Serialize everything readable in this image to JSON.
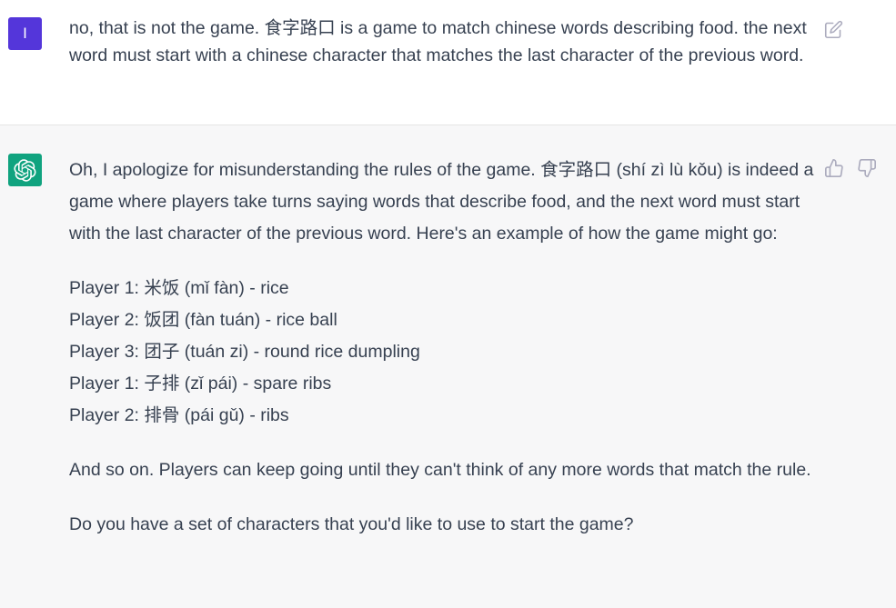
{
  "user_message": {
    "avatar_initial": "I",
    "text": "no, that is not the game. 食字路口 is a game to match chinese words describing food. the next word must start with a chinese character that matches the last character of the previous word."
  },
  "assistant_message": {
    "intro": "Oh, I apologize for misunderstanding the rules of the game. 食字路口 (shí zì lù kǒu) is indeed a game where players take turns saying words that describe food, and the next word must start with the last character of the previous word. Here's an example of how the game might go:",
    "examples": [
      "Player 1: 米饭 (mǐ fàn) - rice",
      "Player 2: 饭团 (fàn tuán) - rice ball",
      "Player 3: 团子 (tuán zi) - round rice dumpling",
      "Player 1: 子排 (zǐ pái) - spare ribs",
      "Player 2: 排骨 (pái gǔ) - ribs"
    ],
    "followup": "And so on. Players can keep going until they can't think of any more words that match the rule.",
    "question": "Do you have a set of characters that you'd like to use to start the game?"
  },
  "icons": {
    "user_avatar_color": "#5436da",
    "bot_avatar_color": "#10a37f",
    "edit": "edit-icon",
    "thumbs_up": "thumbs-up-icon",
    "thumbs_down": "thumbs-down-icon"
  }
}
